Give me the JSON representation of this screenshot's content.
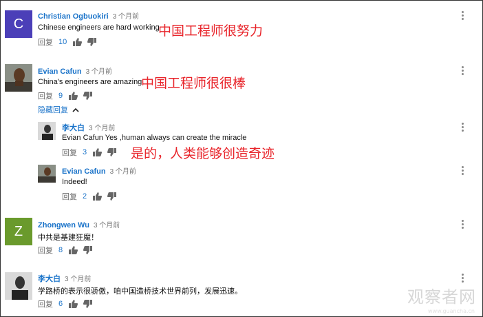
{
  "comments": [
    {
      "author": "Christian Ogbuokiri",
      "time": "3 个月前",
      "avatar_letter": "C",
      "avatar_color": "#4b3fb8",
      "text": "Chinese engineers are hard working",
      "reply_label": "回复",
      "likes": "10",
      "annotation": "中国工程师很努力"
    },
    {
      "author": "Evian Cafun",
      "time": "3 个月前",
      "text": "China's engineers are amazing.",
      "reply_label": "回复",
      "likes": "9",
      "annotation": "中国工程师很很棒",
      "hide_replies": "隐藏回复",
      "replies": [
        {
          "author": "李大白",
          "time": "3 个月前",
          "text": "Evian Cafun Yes ,human always can create the miracle",
          "reply_label": "回复",
          "likes": "3",
          "annotation": "是的，人类能够创造奇迹"
        },
        {
          "author": "Evian Cafun",
          "time": "3 个月前",
          "text": "Indeed!",
          "reply_label": "回复",
          "likes": "2"
        }
      ]
    },
    {
      "author": "Zhongwen Wu",
      "time": "3 个月前",
      "avatar_letter": "Z",
      "avatar_color": "#6a9a2c",
      "text": "中共是基建狂魔！",
      "reply_label": "回复",
      "likes": "8"
    },
    {
      "author": "李大白",
      "time": "3 个月前",
      "text": "学路桥的表示很骄傲，咱中国造桥技术世界前列，发展迅速。",
      "reply_label": "回复",
      "likes": "6"
    }
  ],
  "watermark": "观察者网",
  "watermark_url": "www.guancha.cn"
}
